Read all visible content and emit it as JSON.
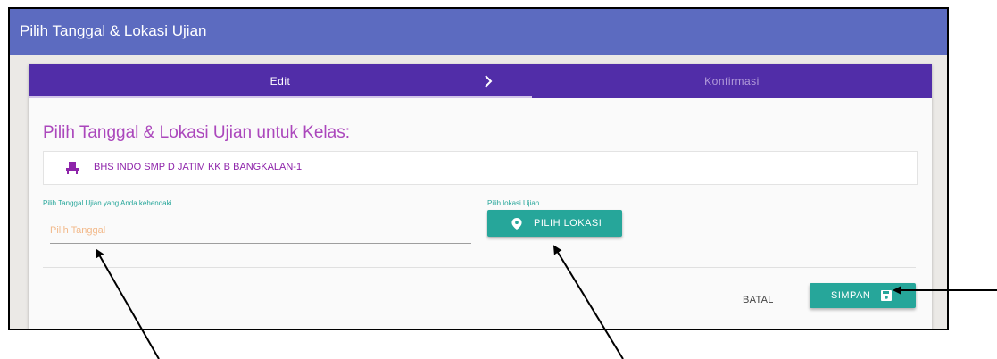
{
  "window": {
    "title": "Pilih Tanggal & Lokasi Ujian"
  },
  "stepper": {
    "steps": [
      "Edit",
      "Konfirmasi"
    ],
    "active_step": "Edit"
  },
  "form": {
    "heading": "Pilih Tanggal & Lokasi Ujian untuk Kelas:",
    "class_name": "BHS INDO SMP D JATIM KK B BANGKALAN-1",
    "date_label": "Pilih Tanggal Ujian yang Anda kehendaki",
    "date_placeholder": "Pilih Tanggal",
    "location_label": "Pilih lokasi Ujian",
    "location_button": "PILIH LOKASI"
  },
  "actions": {
    "cancel": "BATAL",
    "save": "SIMPAN"
  },
  "icons": {
    "class": "event-seat-icon",
    "location": "map-marker-icon",
    "save": "floppy-disk-icon",
    "step_separator": "chevron-right-icon"
  },
  "colors": {
    "titlebar": "#5c6bc0",
    "stepper": "#512da8",
    "heading": "#ab47bc",
    "button": "#26a69a",
    "placeholder": "#f2b98a"
  }
}
